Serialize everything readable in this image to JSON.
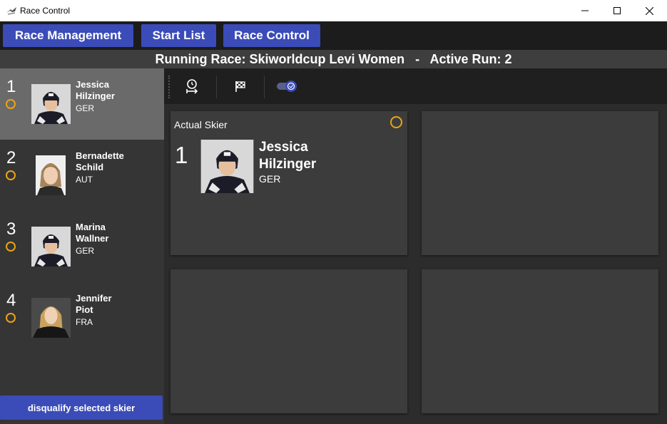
{
  "window": {
    "title": "Race Control",
    "controls": {
      "minimize": "minimize-icon",
      "maximize": "maximize-icon",
      "close": "close-icon"
    }
  },
  "nav": {
    "tabs": [
      {
        "label": "Race Management"
      },
      {
        "label": "Start List"
      },
      {
        "label": "Race Control"
      }
    ]
  },
  "banner": {
    "text": "Running Race: Skiworldcup Levi Women   -   Active Run: 2"
  },
  "skiers": [
    {
      "rank": "1",
      "first_name": "Jessica",
      "last_name": "Hilzinger",
      "nation": "GER",
      "selected": true
    },
    {
      "rank": "2",
      "first_name": "Bernadette",
      "last_name": "Schild",
      "nation": "AUT",
      "selected": false
    },
    {
      "rank": "3",
      "first_name": "Marina",
      "last_name": "Wallner",
      "nation": "GER",
      "selected": false
    },
    {
      "rank": "4",
      "first_name": "Jennifer",
      "last_name": "Piot",
      "nation": "FRA",
      "selected": false
    }
  ],
  "actions": {
    "disqualify_label": "disqualify selected skier"
  },
  "toolbar": {
    "icons": [
      "stopwatch-finish-icon",
      "checkered-flag-icon",
      "toggle-icon"
    ]
  },
  "actual_skier": {
    "heading": "Actual Skier",
    "rank": "1",
    "first_name": "Jessica",
    "last_name": "Hilzinger",
    "nation": "GER"
  },
  "colors": {
    "accent": "#3b4cb8",
    "status_ring": "#e8a317",
    "background": "#2c2c2c",
    "card": "#3c3c3c",
    "selected_row": "#6a6a6a"
  }
}
